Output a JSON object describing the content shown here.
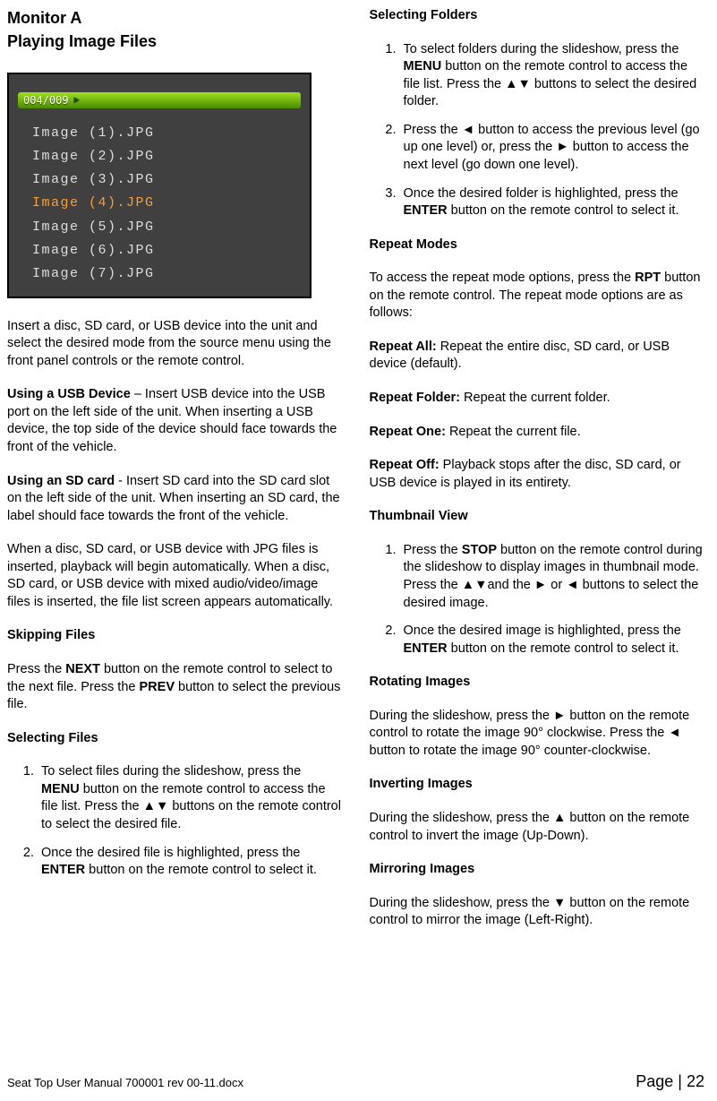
{
  "heading_line1": "Monitor A",
  "heading_line2": "Playing Image Files",
  "screenshot": {
    "counter": "004/009",
    "files": [
      "Image (1).JPG",
      "Image (2).JPG",
      "Image (3).JPG",
      "Image (4).JPG",
      "Image (5).JPG",
      "Image (6).JPG",
      "Image (7).JPG"
    ]
  },
  "col1": {
    "p1": "Insert a disc, SD card, or USB device into the unit and select the desired mode from the source menu using the front panel controls or the remote control.",
    "usb_label": "Using a USB Device",
    "usb_text": " – Insert USB device into the USB port on the left side of the unit. When inserting a USB device, the top side of the device should face towards the front of the vehicle.",
    "sd_label": "Using an SD card",
    "sd_text": " - Insert SD card into the SD card slot on the left side of the unit. When inserting an SD card, the label should face towards the front of the vehicle.",
    "p4": "When a disc, SD card, or USB device with JPG files is inserted, playback will begin automatically. When a disc, SD card, or USB device with mixed audio/video/image files is inserted, the file list screen appears automatically.",
    "skipping_h": "Skipping Files",
    "skipping_pre": "Press the ",
    "skipping_next": "NEXT",
    "skipping_mid": " button on the remote control to select to the next file. Press the ",
    "skipping_prev": "PREV",
    "skipping_post": " button to select the previous file.",
    "selfiles_h": "Selecting Files",
    "selfiles_li1_pre": "To select files during the slideshow, press the ",
    "selfiles_li1_menu": "MENU",
    "selfiles_li1_post": " button on the remote control to access the file list. Press the ▲▼ buttons on the remote control to select the desired file.",
    "selfiles_li2_pre": "Once the desired file is highlighted, press the ",
    "selfiles_li2_enter": "ENTER",
    "selfiles_li2_post": " button on the remote control to select it."
  },
  "col2": {
    "selfolders_h": "Selecting Folders",
    "sf_li1_pre": "To select folders during the slideshow, press the ",
    "sf_li1_menu": "MENU",
    "sf_li1_post": " button on the remote control to access the file list. Press the ▲▼ buttons to select the desired folder.",
    "sf_li2": "Press the ◄ button to access the previous level (go up one level) or, press the ► button to access the next level (go down one level).",
    "sf_li3_pre": "Once the desired folder is highlighted, press the ",
    "sf_li3_enter": "ENTER",
    "sf_li3_post": " button on the remote control to select it.",
    "repeat_h": "Repeat Modes",
    "repeat_intro_pre": "To access the repeat mode options, press the ",
    "repeat_intro_rpt": "RPT",
    "repeat_intro_post": " button on the remote control. The repeat mode options are as follows:",
    "ra_label": "Repeat All:",
    "ra_text": " Repeat the entire disc, SD card, or USB device (default).",
    "rf_label": "Repeat Folder:",
    "rf_text": " Repeat the current folder.",
    "ro_label": "Repeat One:",
    "ro_text": " Repeat the current file.",
    "roff_label": "Repeat Off:",
    "roff_text": " Playback stops after the disc, SD card, or USB device is played in its entirety.",
    "thumb_h": "Thumbnail View",
    "thumb_li1_pre": "Press the ",
    "thumb_li1_stop": "STOP",
    "thumb_li1_post": " button on the remote control during the slideshow to display images in thumbnail mode. Press the ▲▼and the ► or ◄ buttons to select the desired image.",
    "thumb_li2_pre": "Once the desired image is highlighted, press the ",
    "thumb_li2_enter": "ENTER",
    "thumb_li2_post": " button on the remote control to select it.",
    "rot_h": "Rotating Images",
    "rot_p": "During the slideshow, press the ► button on the remote control to rotate the image 90° clockwise. Press the ◄ button to rotate the image 90° counter-clockwise.",
    "inv_h": "Inverting Images",
    "inv_p": "During the slideshow, press the ▲ button on the remote control to invert the image (Up-Down).",
    "mir_h": "Mirroring Images",
    "mir_p": "During the slideshow, press the ▼ button on the remote control to mirror the image (Left-Right)."
  },
  "footer": {
    "filename": "Seat Top User Manual 700001 rev 00-11.docx",
    "page": "Page | 22"
  }
}
